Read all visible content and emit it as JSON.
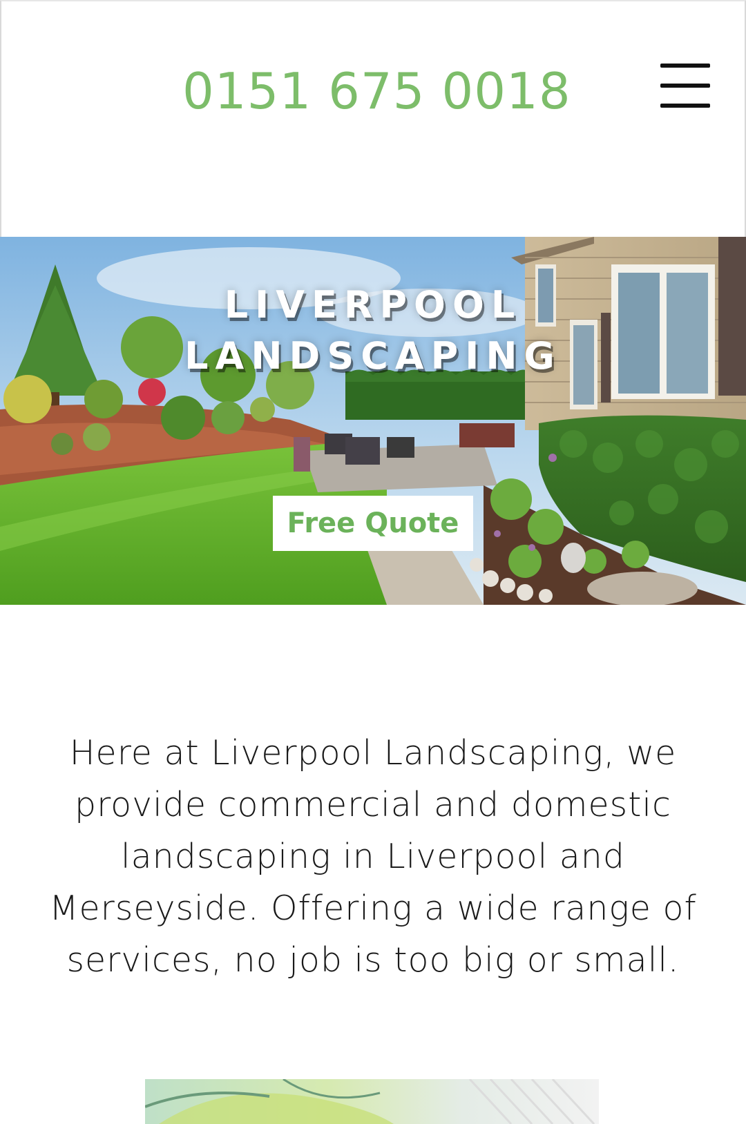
{
  "header": {
    "phone": "0151 675 0018",
    "menu_icon": "hamburger-menu-icon"
  },
  "hero": {
    "title_line1": "LIVERPOOL",
    "title_line2": "LANDSCAPING",
    "cta_label": "Free Quote"
  },
  "intro": {
    "text": "Here at Liverpool Landscaping, we provide commercial and domestic landscaping in Liverpool and Merseyside. Offering a wide range of services, no job is too big or small."
  },
  "colors": {
    "brand_green": "#7dbd6a",
    "text_dark": "#1a1a1a"
  }
}
